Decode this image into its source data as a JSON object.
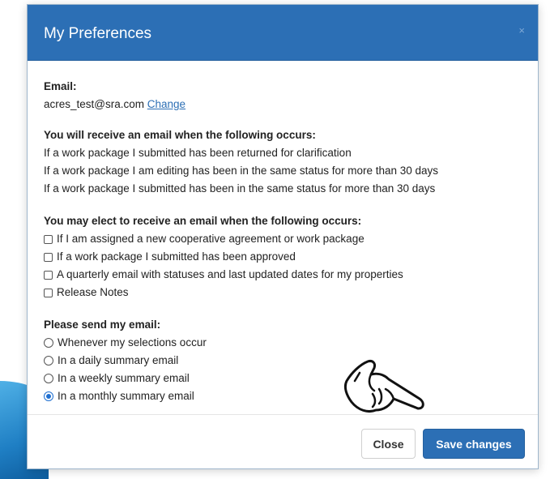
{
  "modal": {
    "title": "My Preferences",
    "close_glyph": "×"
  },
  "email": {
    "label": "Email:",
    "address": "acres_test@sra.com",
    "change_link": "Change"
  },
  "auto_notifications": {
    "heading": "You will receive an email when the following occurs:",
    "items": [
      "If a work package I submitted has been returned for clarification",
      "If a work package I am editing has been in the same status for more than 30 days",
      "If a work package I submitted has been in the same status for more than 30 days"
    ]
  },
  "optional_notifications": {
    "heading": "You may elect to receive an email when the following occurs:",
    "items": [
      {
        "label": "If I am assigned a new cooperative agreement or work package",
        "checked": false
      },
      {
        "label": "If a work package I submitted has been approved",
        "checked": false
      },
      {
        "label": "A quarterly email with statuses and last updated dates for my properties",
        "checked": false
      },
      {
        "label": "Release Notes",
        "checked": false
      }
    ]
  },
  "frequency": {
    "heading": "Please send my email:",
    "options": [
      {
        "label": "Whenever my selections occur",
        "selected": false
      },
      {
        "label": "In a daily summary email",
        "selected": false
      },
      {
        "label": "In a weekly summary email",
        "selected": false
      },
      {
        "label": "In a monthly summary email",
        "selected": true
      }
    ]
  },
  "footer": {
    "close_label": "Close",
    "save_label": "Save changes"
  },
  "colors": {
    "header": "#2c6fb5",
    "primary_button": "#2c6fb5",
    "link": "#2c6fb5"
  },
  "icons": {
    "pointer": "hand-pointer-icon"
  }
}
